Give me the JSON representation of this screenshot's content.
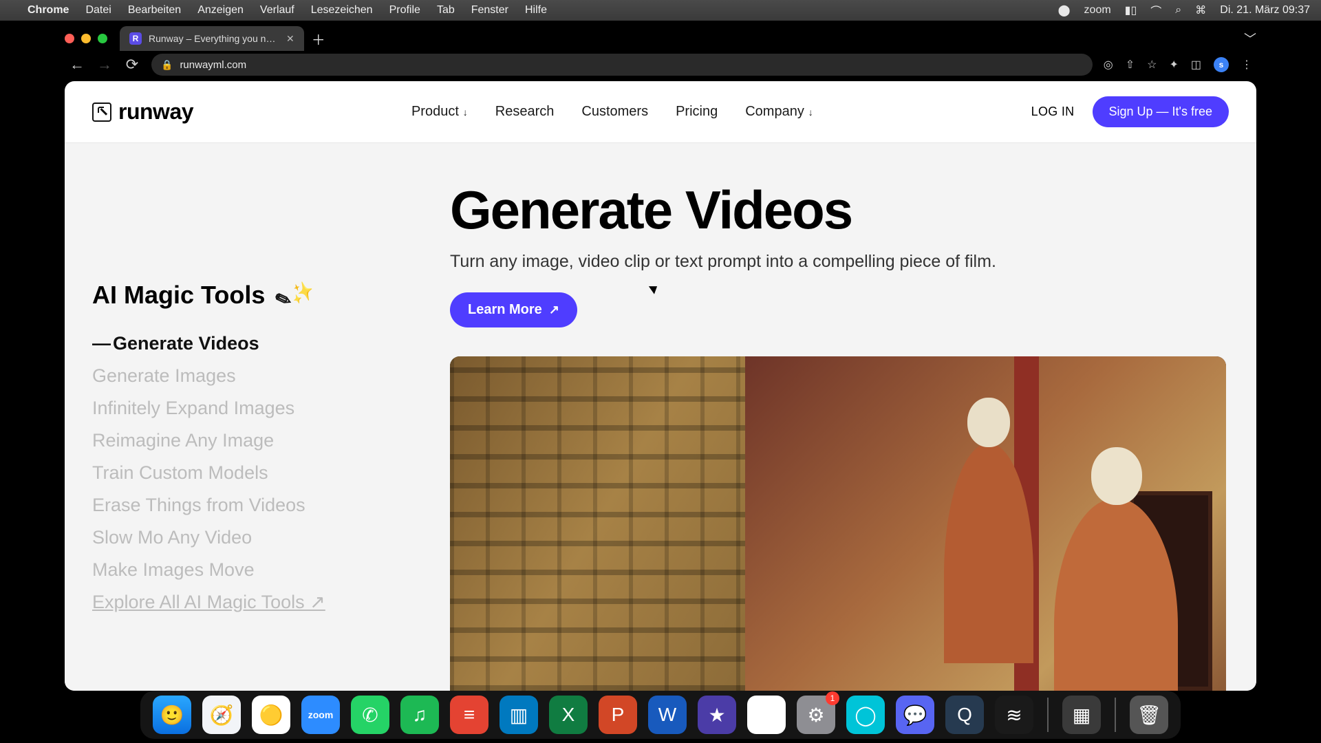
{
  "mac_menu": {
    "app": "Chrome",
    "items": [
      "Datei",
      "Bearbeiten",
      "Anzeigen",
      "Verlauf",
      "Lesezeichen",
      "Profile",
      "Tab",
      "Fenster",
      "Hilfe"
    ],
    "zoom_label": "zoom",
    "clock": "Di. 21. März  09:37"
  },
  "browser": {
    "tab_title": "Runway – Everything you need",
    "url": "runwayml.com",
    "avatar_letter": "s"
  },
  "header": {
    "brand": "runway",
    "nav": {
      "product": "Product",
      "research": "Research",
      "customers": "Customers",
      "pricing": "Pricing",
      "company": "Company"
    },
    "login": "LOG IN",
    "signup": "Sign Up — It's free"
  },
  "sidebar": {
    "title": "AI Magic Tools",
    "tools": [
      "Generate Videos",
      "Generate Images",
      "Infinitely Expand Images",
      "Reimagine Any Image",
      "Train Custom Models",
      "Erase Things from Videos",
      "Slow Mo Any Video",
      "Make Images Move"
    ],
    "explore": "Explore All AI Magic Tools ↗"
  },
  "content": {
    "headline": "Generate Videos",
    "subhead": "Turn any image, video clip or text prompt into a compelling piece of film.",
    "learn_more": "Learn More"
  },
  "dock": {
    "settings_badge": "1",
    "zoom_text": "zoom"
  }
}
